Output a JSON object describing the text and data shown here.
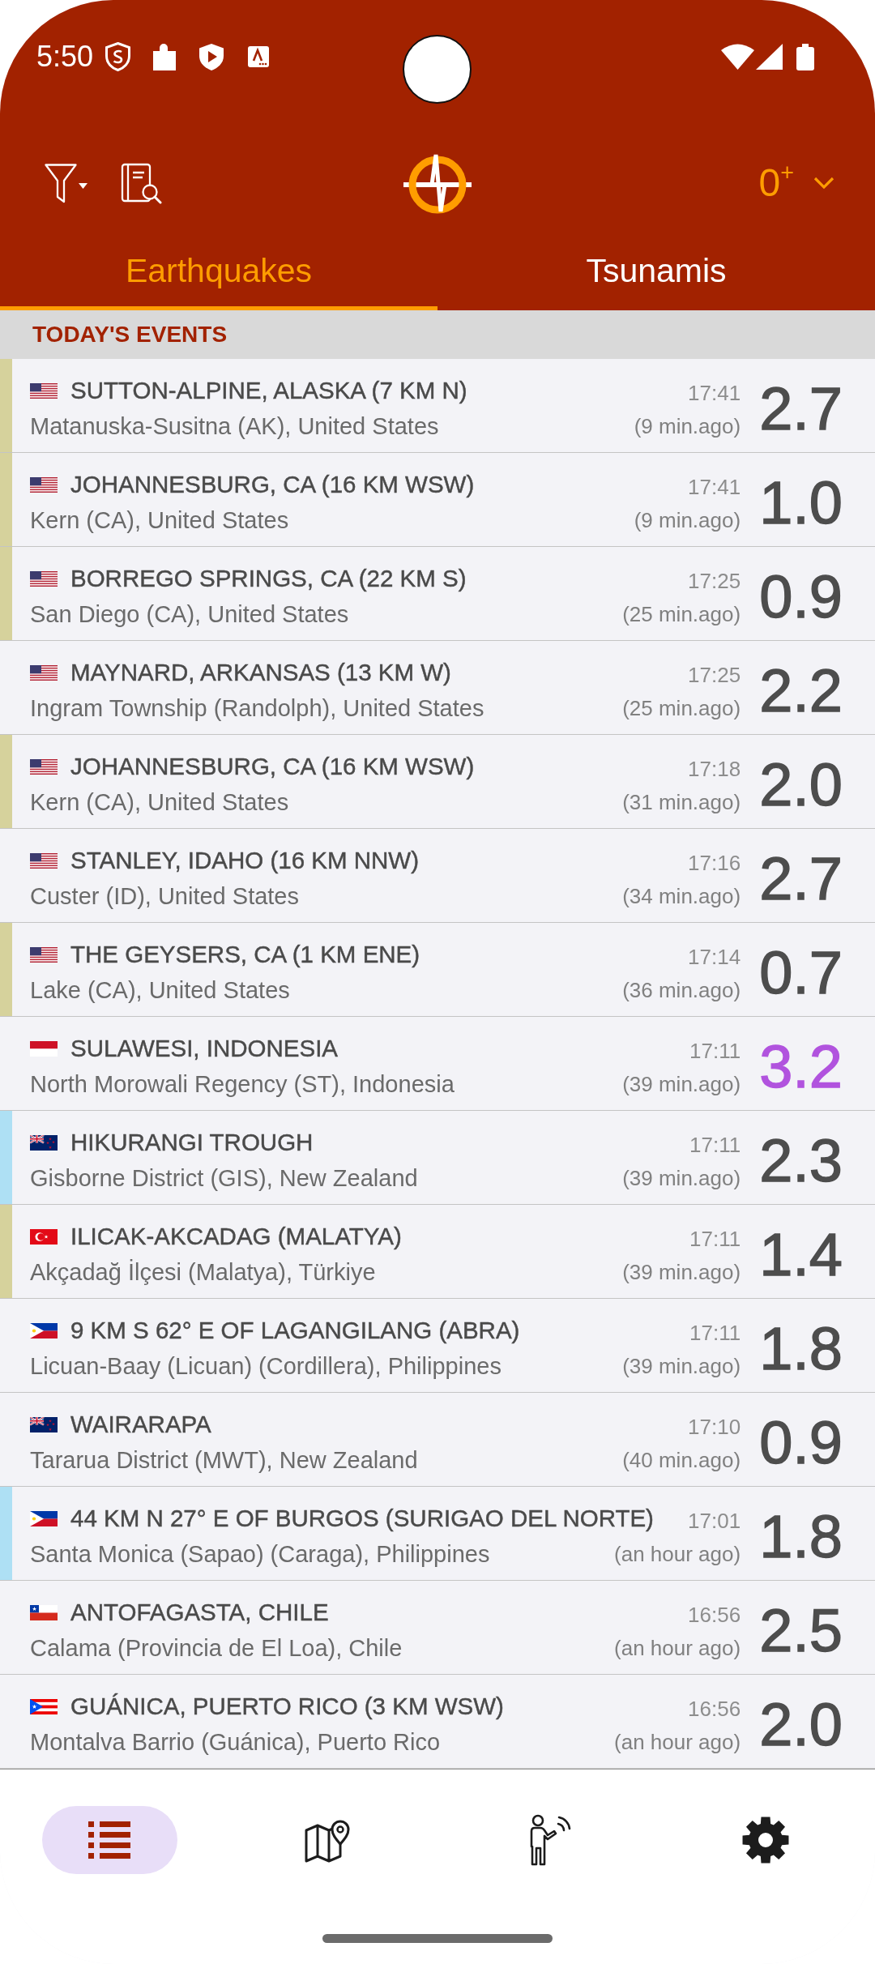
{
  "status_bar": {
    "time": "5:50"
  },
  "toolbar": {
    "magnitude_filter": "0$^{+}$"
  },
  "tabs": [
    {
      "label": "Earthquakes",
      "selected": true
    },
    {
      "label": "Tsunamis",
      "selected": false
    }
  ],
  "section": {
    "title": "TODAY'S EVENTS"
  },
  "events": [
    {
      "flag": {
        "kind": "us"
      },
      "title": "SUTTON-ALPINE, ALASKA (7 KM N)",
      "region": "Matanuska-Susitna (AK), United States",
      "time": "17:41",
      "ago": "(9 min.ago)",
      "magnitude": {
        "text": "2.7",
        "color": "#4d4d4d"
      },
      "stripe": {
        "color": "#d6d29c"
      }
    },
    {
      "flag": {
        "kind": "us"
      },
      "title": "JOHANNESBURG, CA (16 KM WSW)",
      "region": "Kern (CA), United States",
      "time": "17:41",
      "ago": "(9 min.ago)",
      "magnitude": {
        "text": "1.0",
        "color": "#4d4d4d"
      },
      "stripe": {
        "color": "#d6d29c"
      }
    },
    {
      "flag": {
        "kind": "us"
      },
      "title": "BORREGO SPRINGS, CA (22 KM S)",
      "region": "San Diego (CA), United States",
      "time": "17:25",
      "ago": "(25 min.ago)",
      "magnitude": {
        "text": "0.9",
        "color": "#4d4d4d"
      },
      "stripe": {
        "color": "#d6d29c"
      }
    },
    {
      "flag": {
        "kind": "us"
      },
      "title": "MAYNARD, ARKANSAS (13 KM W)",
      "region": "Ingram Township (Randolph), United States",
      "time": "17:25",
      "ago": "(25 min.ago)",
      "magnitude": {
        "text": "2.2",
        "color": "#4d4d4d"
      }
    },
    {
      "flag": {
        "kind": "us"
      },
      "title": "JOHANNESBURG, CA (16 KM WSW)",
      "region": "Kern (CA), United States",
      "time": "17:18",
      "ago": "(31 min.ago)",
      "magnitude": {
        "text": "2.0",
        "color": "#4d4d4d"
      },
      "stripe": {
        "color": "#d6d29c"
      }
    },
    {
      "flag": {
        "kind": "us"
      },
      "title": "STANLEY, IDAHO (16 KM NNW)",
      "region": "Custer (ID), United States",
      "time": "17:16",
      "ago": "(34 min.ago)",
      "magnitude": {
        "text": "2.7",
        "color": "#4d4d4d"
      }
    },
    {
      "flag": {
        "kind": "us"
      },
      "title": "THE GEYSERS, CA (1 KM ENE)",
      "region": "Lake (CA), United States",
      "time": "17:14",
      "ago": "(36 min.ago)",
      "magnitude": {
        "text": "0.7",
        "color": "#4d4d4d"
      },
      "stripe": {
        "color": "#d6d29c"
      }
    },
    {
      "flag": {
        "kind": "id"
      },
      "title": "SULAWESI, INDONESIA",
      "region": "North Morowali Regency (ST), Indonesia",
      "time": "17:11",
      "ago": "(39 min.ago)",
      "magnitude": {
        "text": "3.2",
        "color": "#b153de"
      }
    },
    {
      "flag": {
        "kind": "nz"
      },
      "title": "HIKURANGI TROUGH",
      "region": "Gisborne District (GIS), New Zealand",
      "time": "17:11",
      "ago": "(39 min.ago)",
      "magnitude": {
        "text": "2.3",
        "color": "#4d4d4d"
      },
      "stripe": {
        "color": "#aee0f4"
      }
    },
    {
      "flag": {
        "kind": "tr"
      },
      "title": "ILICAK-AKCADAG (MALATYA)",
      "region": "Akçadağ İlçesi (Malatya), Türkiye",
      "time": "17:11",
      "ago": "(39 min.ago)",
      "magnitude": {
        "text": "1.4",
        "color": "#4d4d4d"
      },
      "stripe": {
        "color": "#d6d29c"
      }
    },
    {
      "flag": {
        "kind": "ph"
      },
      "title": "9 KM S 62° E OF LAGANGILANG (ABRA)",
      "region": "Licuan-Baay (Licuan) (Cordillera), Philippines",
      "time": "17:11",
      "ago": "(39 min.ago)",
      "magnitude": {
        "text": "1.8",
        "color": "#4d4d4d"
      }
    },
    {
      "flag": {
        "kind": "nz"
      },
      "title": "WAIRARAPA",
      "region": "Tararua District (MWT), New Zealand",
      "time": "17:10",
      "ago": "(40 min.ago)",
      "magnitude": {
        "text": "0.9",
        "color": "#4d4d4d"
      }
    },
    {
      "flag": {
        "kind": "ph"
      },
      "title": "44 KM N 27° E OF BURGOS (SURIGAO DEL NORTE)",
      "region": "Santa Monica (Sapao) (Caraga), Philippines",
      "time": "17:01",
      "ago": "(an hour ago)",
      "magnitude": {
        "text": "1.8",
        "color": "#4d4d4d"
      },
      "stripe": {
        "color": "#aee0f4"
      }
    },
    {
      "flag": {
        "kind": "cl"
      },
      "title": "ANTOFAGASTA, CHILE",
      "region": "Calama (Provincia de El Loa), Chile",
      "time": "16:56",
      "ago": "(an hour ago)",
      "magnitude": {
        "text": "2.5",
        "color": "#4d4d4d"
      }
    },
    {
      "flag": {
        "kind": "pr"
      },
      "title": "GUÁNICA, PUERTO RICO (3 KM WSW)",
      "region": "Montalva Barrio (Guánica), Puerto Rico",
      "time": "16:56",
      "ago": "(an hour ago)",
      "magnitude": {
        "text": "2.0",
        "color": "#4d4d4d"
      }
    }
  ],
  "bottom_nav": [
    {
      "kind": "list",
      "selected": true
    },
    {
      "kind": "map",
      "selected": false
    },
    {
      "kind": "person",
      "selected": false
    },
    {
      "kind": "settings",
      "selected": false
    }
  ]
}
